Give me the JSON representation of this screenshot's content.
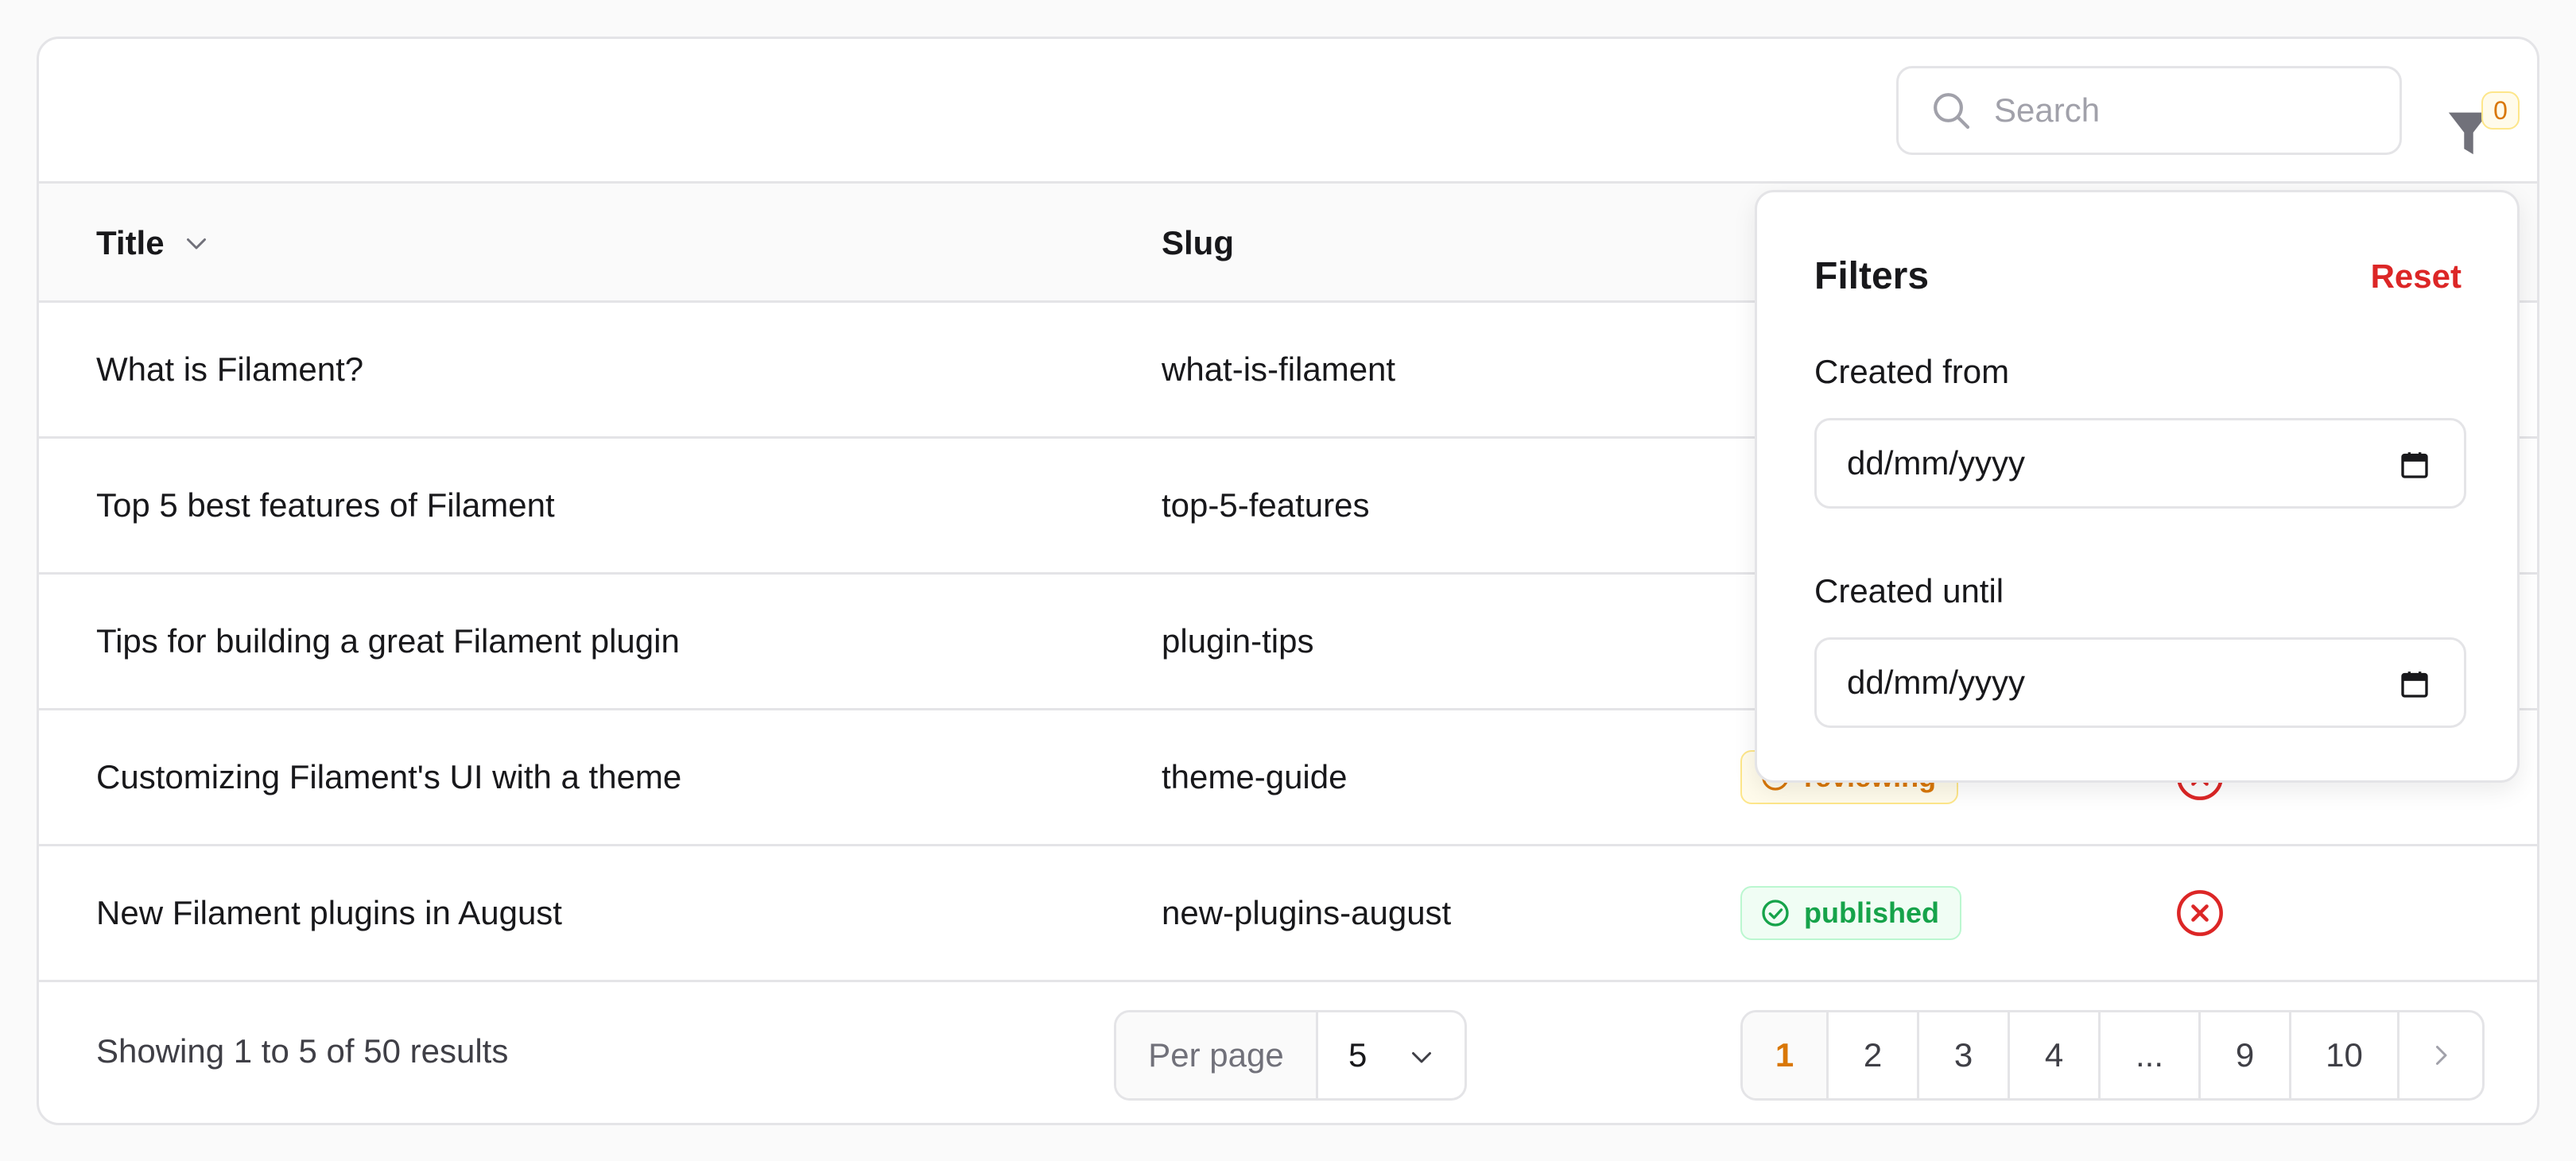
{
  "search": {
    "placeholder": "Search"
  },
  "filter": {
    "count": "0"
  },
  "columns": {
    "title": "Title",
    "slug": "Slug"
  },
  "rows": [
    {
      "title": "What is Filament?",
      "slug": "what-is-filament",
      "status": "",
      "featured": ""
    },
    {
      "title": "Top 5 best features of Filament",
      "slug": "top-5-features",
      "status": "",
      "featured": ""
    },
    {
      "title": "Tips for building a great Filament plugin",
      "slug": "plugin-tips",
      "status": "",
      "featured": ""
    },
    {
      "title": "Customizing Filament's UI with a theme",
      "slug": "theme-guide",
      "status": "reviewing",
      "status_icon": "clock-icon",
      "featured": "x-circle-icon"
    },
    {
      "title": "New Filament plugins in August",
      "slug": "new-plugins-august",
      "status": "published",
      "status_icon": "check-circle-icon",
      "featured": "x-circle-icon"
    }
  ],
  "footer": {
    "summary": "Showing 1 to 5 of 50 results",
    "per_page_label": "Per page",
    "per_page_value": "5",
    "pages": [
      "1",
      "2",
      "3",
      "4",
      "...",
      "9",
      "10"
    ],
    "active_page": "1"
  },
  "filters_panel": {
    "title": "Filters",
    "reset": "Reset",
    "created_from_label": "Created from",
    "created_from_value": "dd/mm/yyyy",
    "created_until_label": "Created until",
    "created_until_value": "dd/mm/yyyy"
  },
  "colors": {
    "accent": "#d97706",
    "danger": "#dc2626",
    "success": "#16a34a",
    "border": "#e4e4e7"
  }
}
